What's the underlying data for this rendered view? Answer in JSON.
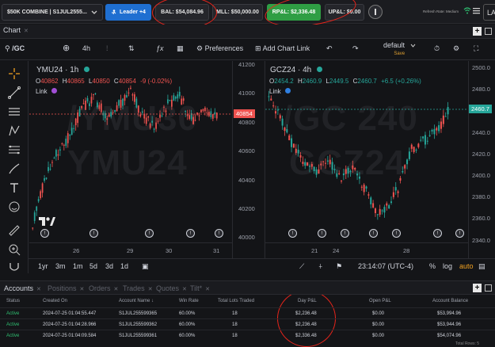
{
  "topbar": {
    "account_select": "$50K COMBINE | S1JUL2555...",
    "leader_button": "Leader +4",
    "bal": "BAL: $54,084.96",
    "mll": "MLL: $50,000.00",
    "rpl": "RP&L: $2,336.48",
    "upl": "UP&L: $0.00",
    "refresh_rate": "Refresh Rate: Medium",
    "lang": "LA"
  },
  "chart_tab": {
    "label": "Chart"
  },
  "toolbar": {
    "symbol": "/GC",
    "interval": "4h",
    "preferences": "Preferences",
    "add_chart_link": "Add Chart Link",
    "layout_name": "default",
    "layout_sub": "Save"
  },
  "left_chart": {
    "title": "YMU24 · 1h",
    "ohlc": {
      "o_label": "O",
      "o": "40862",
      "h_label": "H",
      "h": "40865",
      "l_label": "L",
      "l": "40850",
      "c_label": "C",
      "c": "40854",
      "chg": "-9 (-0.02%)"
    },
    "link": "Link",
    "watermark1": "/YMU30",
    "watermark2": "YMU24",
    "price_tag": "40854",
    "y_ticks": [
      "41200",
      "41000",
      "40800",
      "40600",
      "40400",
      "40200",
      "40000"
    ],
    "x_ticks": [
      "26",
      "29",
      "30",
      "31"
    ]
  },
  "right_chart": {
    "title": "GCZ24 · 4h",
    "ohlc": {
      "o_label": "O",
      "o": "2454.2",
      "h_label": "H",
      "h": "2460.9",
      "l_label": "L",
      "l": "2449.5",
      "c_label": "C",
      "c": "2460.7",
      "chg": "+6.5 (+0.26%)"
    },
    "link": "Link",
    "watermark1": "/GC 240",
    "watermark2": "GCZ24",
    "price_tag": "2460.7",
    "y_ticks": [
      "2500.0",
      "2480.0",
      "2460.0",
      "2440.0",
      "2420.0",
      "2400.0",
      "2380.0",
      "2360.0",
      "2340.0"
    ],
    "x_ticks": [
      "21",
      "24",
      "28"
    ]
  },
  "bottom_bar": {
    "ranges": [
      "1yr",
      "3m",
      "1m",
      "5d",
      "3d",
      "1d"
    ],
    "clock": "23:14:07 (UTC-4)",
    "pct": "%",
    "log": "log",
    "auto": "auto"
  },
  "accounts_tabs": [
    "Accounts",
    "Positions",
    "Orders",
    "Trades",
    "Quotes",
    "Tilt*"
  ],
  "accounts_table": {
    "headers": [
      "Status",
      "Created On",
      "Account Name",
      "Win Rate",
      "Total Lots Traded",
      "Day P&L",
      "Open P&L",
      "Account Balance"
    ],
    "rows": [
      [
        "Active",
        "2024-07-25 01:04:55.447",
        "S1JUL255599365",
        "60.00%",
        "18",
        "$2,236.48",
        "$0.00",
        "$53,994.96"
      ],
      [
        "Active",
        "2024-07-25 01:04:28.966",
        "S1JUL255599362",
        "60.00%",
        "18",
        "$2,236.48",
        "$0.00",
        "$53,944.96"
      ],
      [
        "Active",
        "2024-07-25 01:04:09.584",
        "S1JUL255599361",
        "60.00%",
        "18",
        "$2,336.48",
        "$0.00",
        "$54,074.96"
      ]
    ],
    "footer": "Total Rows: 5"
  },
  "colors": {
    "up": "#26a69a",
    "down": "#ef5350",
    "accent_blue": "#1f6fd1",
    "green_pill": "#2f9e44",
    "annotation": "#e8251b"
  }
}
